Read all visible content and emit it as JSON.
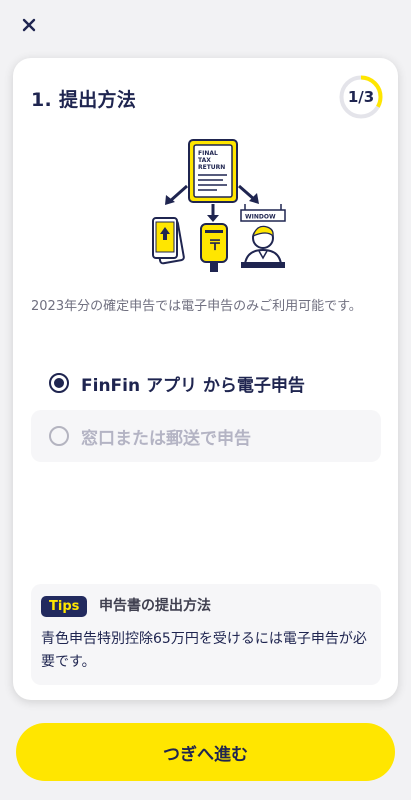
{
  "header": {
    "close_icon": "close-icon"
  },
  "step": {
    "title": "1. 提出方法",
    "progress_label": "1/3",
    "progress_fraction": 0.333,
    "accent_color": "#ffe600"
  },
  "illustration": {
    "document_title_lines": [
      "FINAL",
      "TAX",
      "RETURN"
    ],
    "window_sign": "WINDOW",
    "post_mark": "〒"
  },
  "description": "2023年分の確定申告では電子申告のみご利用可能です。",
  "options": [
    {
      "label": "FinFin アプリ から電子申告",
      "selected": true,
      "enabled": true
    },
    {
      "label": "窓口または郵送で申告",
      "selected": false,
      "enabled": false
    }
  ],
  "tips": {
    "badge": "Tips",
    "heading": "申告書の提出方法",
    "body": "青色申告特別控除65万円を受けるには電子申告が必要です。"
  },
  "footer": {
    "next_label": "つぎへ進む"
  },
  "colors": {
    "navy": "#1f2550",
    "yellow": "#ffe600",
    "background": "#f2f2f4"
  }
}
